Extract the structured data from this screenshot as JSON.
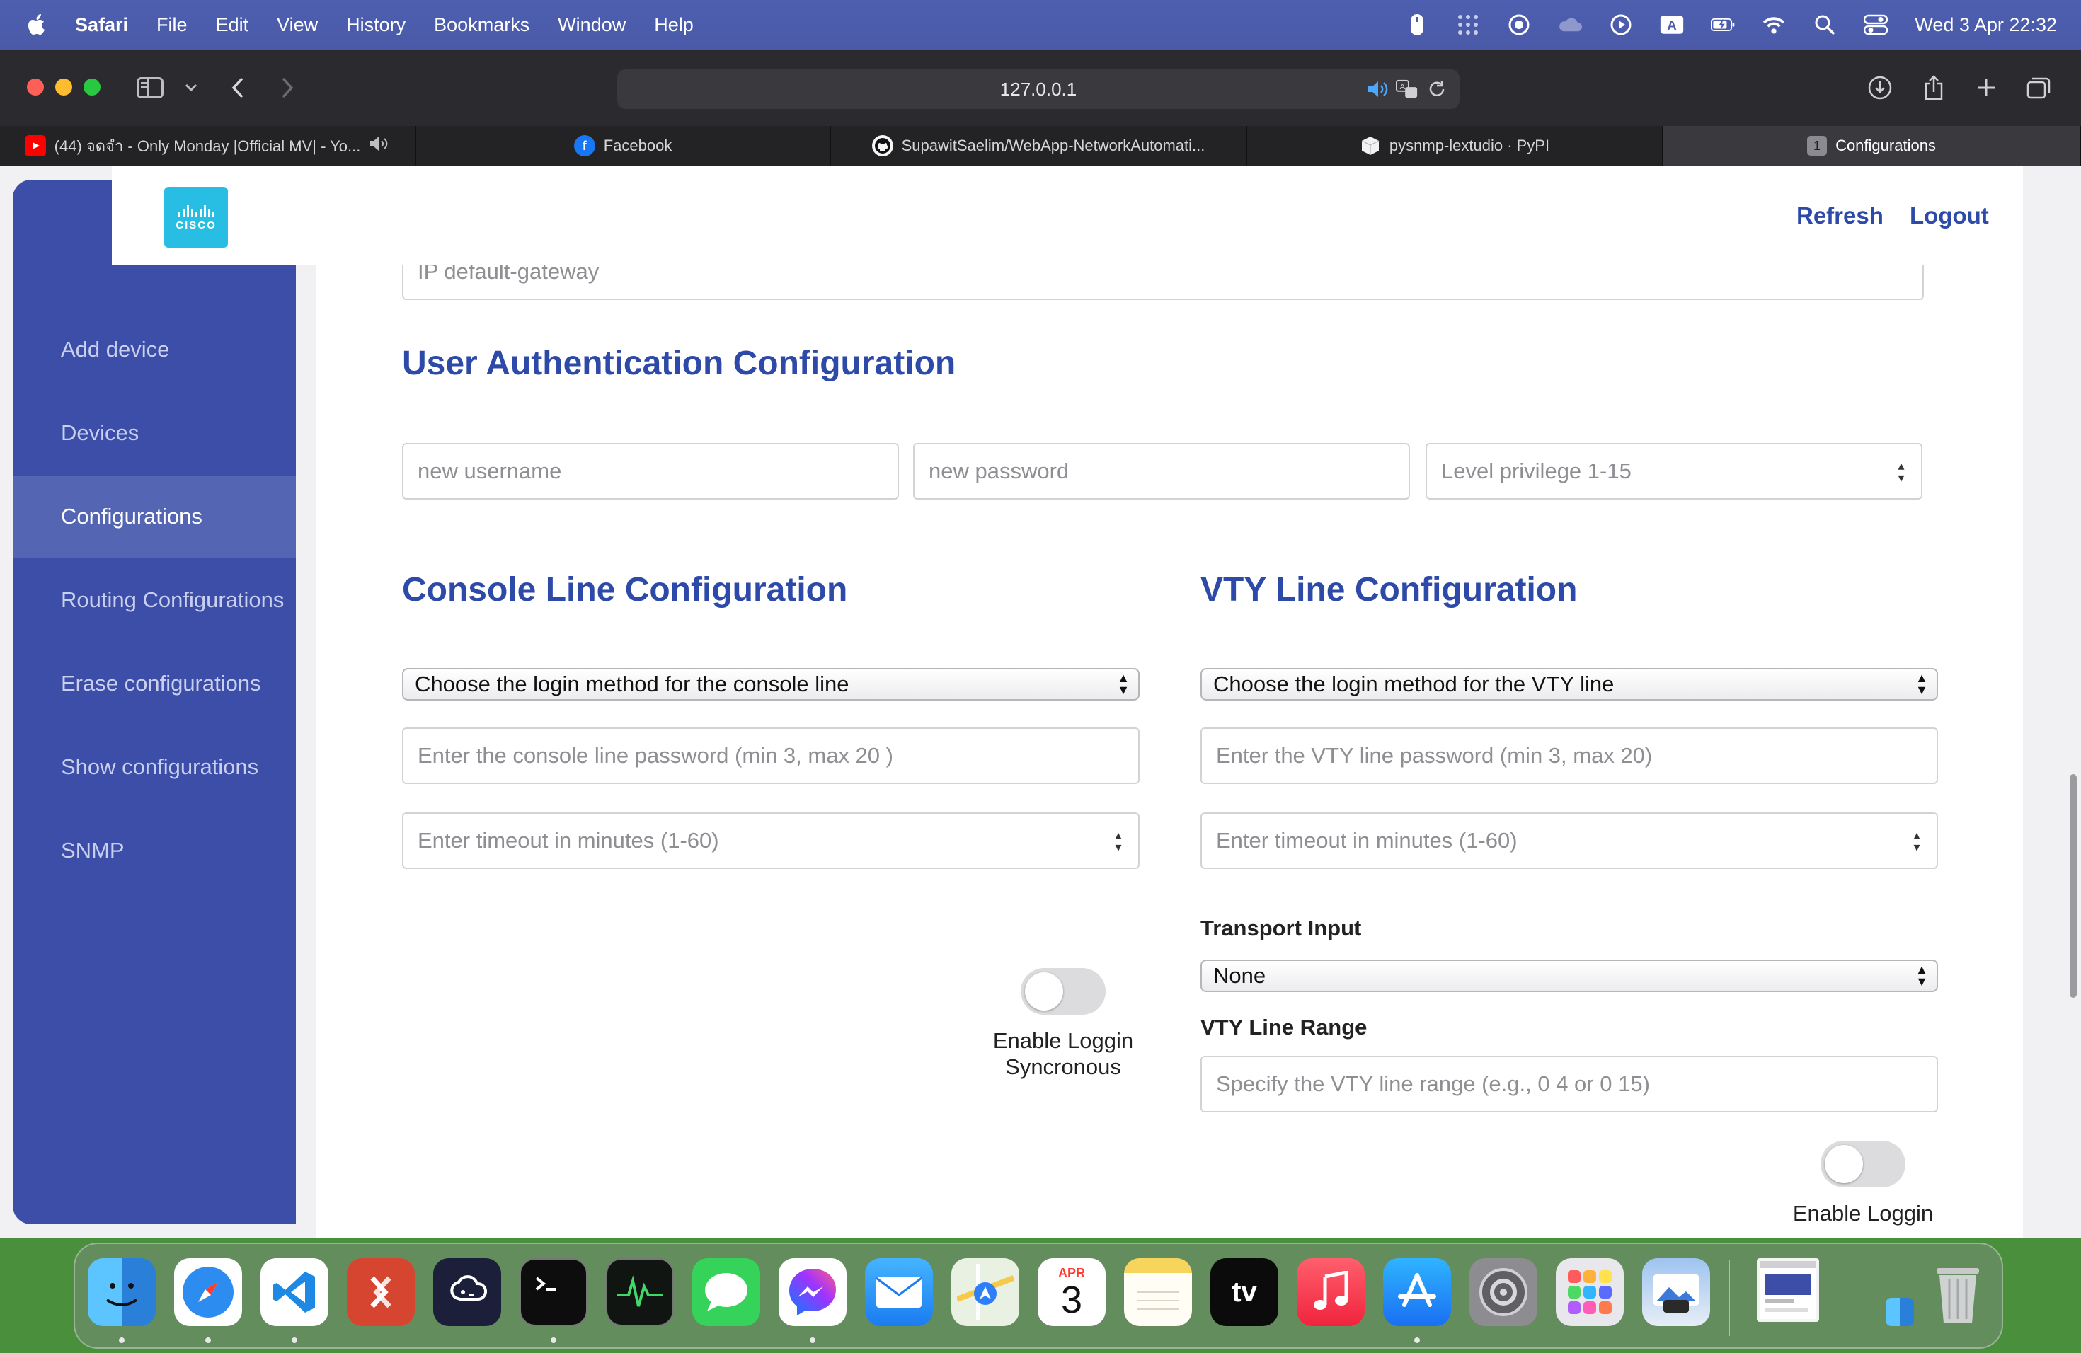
{
  "menubar": {
    "app_name": "Safari",
    "items": [
      "File",
      "Edit",
      "View",
      "History",
      "Bookmarks",
      "Window",
      "Help"
    ],
    "clock": "Wed 3 Apr  22:32",
    "status_icons": [
      "mouse-icon",
      "grid-dots-icon",
      "record-icon",
      "cloud-icon",
      "play-icon",
      "keyboard-a-icon",
      "battery-icon",
      "wifi-icon",
      "search-icon",
      "control-center-icon"
    ]
  },
  "browser": {
    "url": "127.0.0.1",
    "tabs": [
      {
        "title": "(44) จดจำ - Only Monday |Official MV| - Yo...",
        "icon": "youtube-icon",
        "muted_icon": "speaker-icon"
      },
      {
        "title": "Facebook",
        "icon": "facebook-icon"
      },
      {
        "title": "SupawitSaelim/WebApp-NetworkAutomati...",
        "icon": "github-icon"
      },
      {
        "title": "pysnmp-lextudio · PyPI",
        "icon": "pypi-icon"
      },
      {
        "title": "Configurations",
        "icon": "tab-count-icon",
        "count": "1"
      }
    ]
  },
  "header": {
    "refresh": "Refresh",
    "logout": "Logout",
    "logo_text": "CISCO"
  },
  "sidebar": {
    "items": [
      {
        "label": "Add device"
      },
      {
        "label": "Devices"
      },
      {
        "label": "Configurations",
        "active": true
      },
      {
        "label": "Routing Configurations"
      },
      {
        "label": "Erase configurations"
      },
      {
        "label": "Show configurations"
      },
      {
        "label": "SNMP"
      }
    ]
  },
  "form": {
    "gateway_placeholder": "IP default-gateway",
    "user_auth": {
      "title": "User Authentication Configuration",
      "username_placeholder": "new username",
      "password_placeholder": "new password",
      "privilege_placeholder": "Level privilege 1-15"
    },
    "console": {
      "title": "Console Line Configuration",
      "login_method": "Choose the login method for the console line",
      "password_placeholder": "Enter the console line password (min 3, max 20 )",
      "timeout_placeholder": "Enter timeout in minutes (1-60)",
      "toggle_label_1": "Enable Loggin",
      "toggle_label_2": "Syncronous"
    },
    "vty": {
      "title": "VTY Line Configuration",
      "login_method": "Choose the login method for the VTY line",
      "password_placeholder": "Enter the VTY line password (min 3, max 20)",
      "timeout_placeholder": "Enter timeout in minutes (1-60)",
      "transport_label": "Transport Input",
      "transport_value": "None",
      "range_label": "VTY Line Range",
      "range_placeholder": "Specify the VTY line range (e.g., 0 4 or 0 15)",
      "toggle_label": "Enable Loggin"
    }
  },
  "dock": {
    "calendar_month": "APR",
    "calendar_day": "3",
    "tv_label": "tv"
  },
  "colors": {
    "sidebar": "#3c4ea7",
    "sidebar_active": "#5465b3",
    "title_blue": "#2e4aa8",
    "cisco": "#28bde3"
  }
}
